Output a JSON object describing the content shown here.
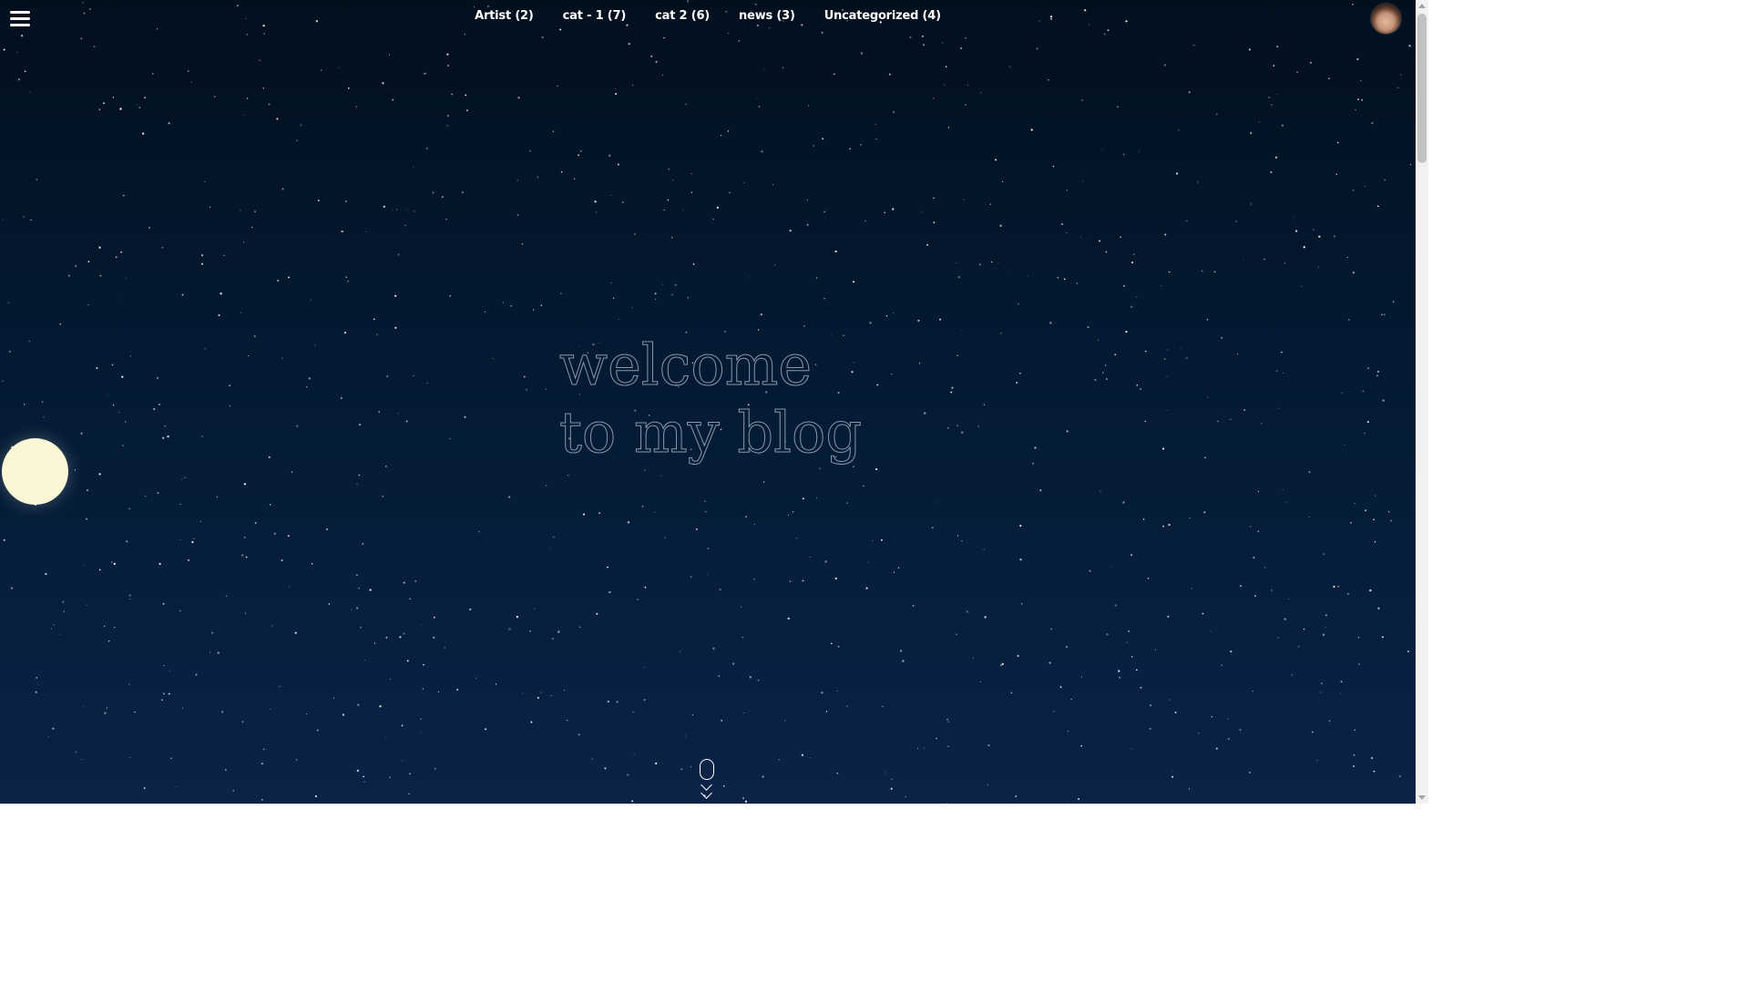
{
  "nav": {
    "items": [
      {
        "label": "Artist (2)"
      },
      {
        "label": "cat - 1 (7)"
      },
      {
        "label": "cat 2 (6)"
      },
      {
        "label": "news (3)"
      },
      {
        "label": "Uncategorized (4)"
      }
    ]
  },
  "hero": {
    "line1": "welcome",
    "line2": "to my blog"
  },
  "icons": {
    "menu": "hamburger-menu-icon",
    "avatar": "user-avatar",
    "moon": "moon-icon",
    "scroll": "scroll-down-mouse-icon"
  },
  "colors": {
    "background_top": "#02101e",
    "background_bottom": "#0a2347",
    "moon": "#fbf6d6",
    "nav_text": "#ffffff",
    "hero_outline": "#8a97a8"
  }
}
